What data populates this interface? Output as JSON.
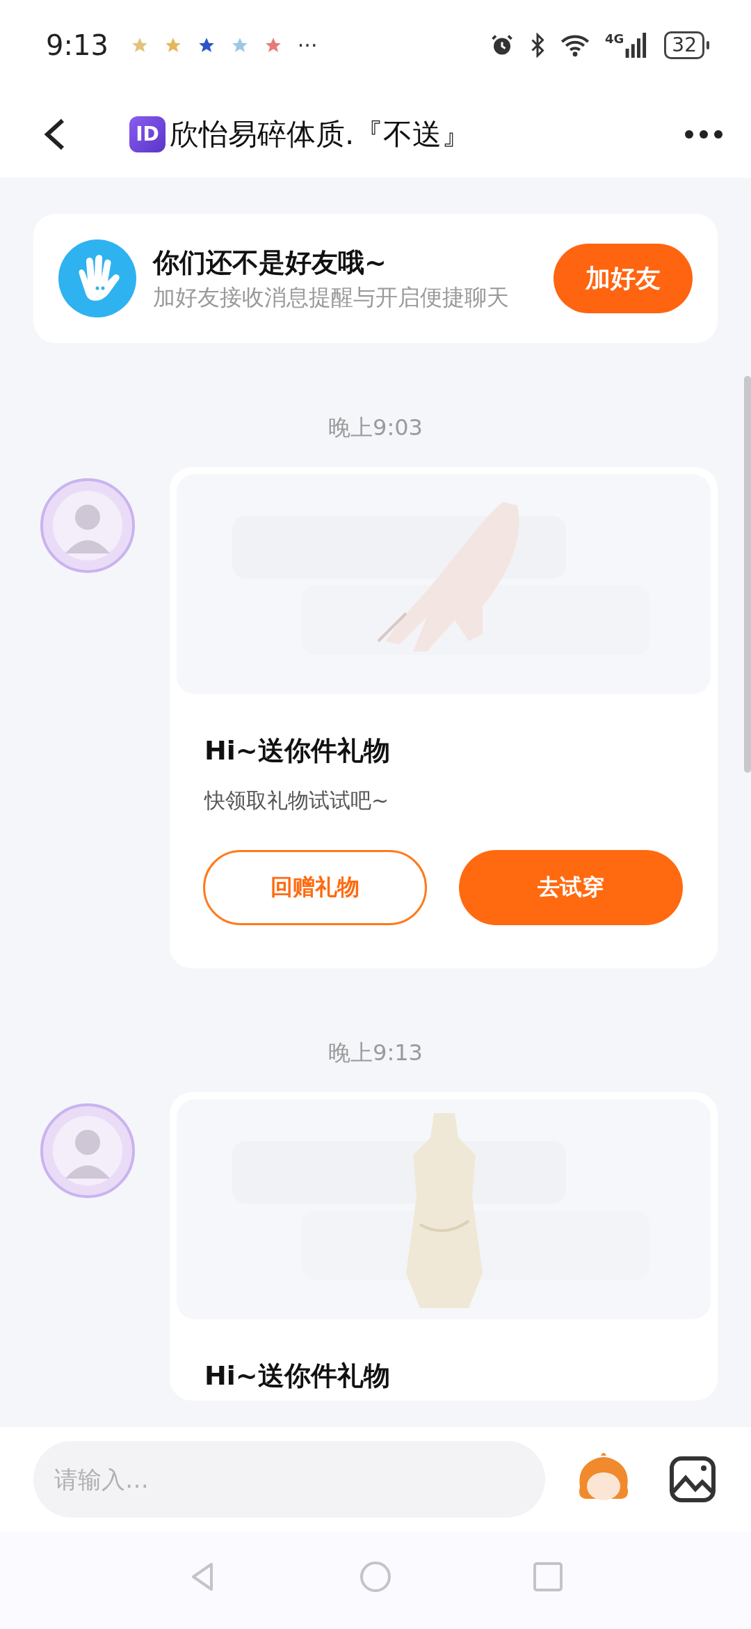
{
  "status_bar": {
    "time": "9:13",
    "more": "···",
    "network": "4G",
    "battery": "32"
  },
  "header": {
    "id_badge": "ID",
    "title": "欣怡易碎体质.『不送』"
  },
  "friend_banner": {
    "title": "你们还不是好友哦~",
    "message": "加好友接收消息提醒与开启便捷聊天",
    "button": "加好友"
  },
  "messages": [
    {
      "time": "晚上9:03",
      "title": "Hi~送你件礼物",
      "subtitle": "快领取礼物试试吧~",
      "buttons": [
        {
          "label": "回赠礼物",
          "kind": "outline"
        },
        {
          "label": "去试穿",
          "kind": "filled"
        }
      ]
    },
    {
      "time": "晚上9:13",
      "title": "Hi~送你件礼物"
    }
  ],
  "composer": {
    "placeholder": "请输入…"
  }
}
